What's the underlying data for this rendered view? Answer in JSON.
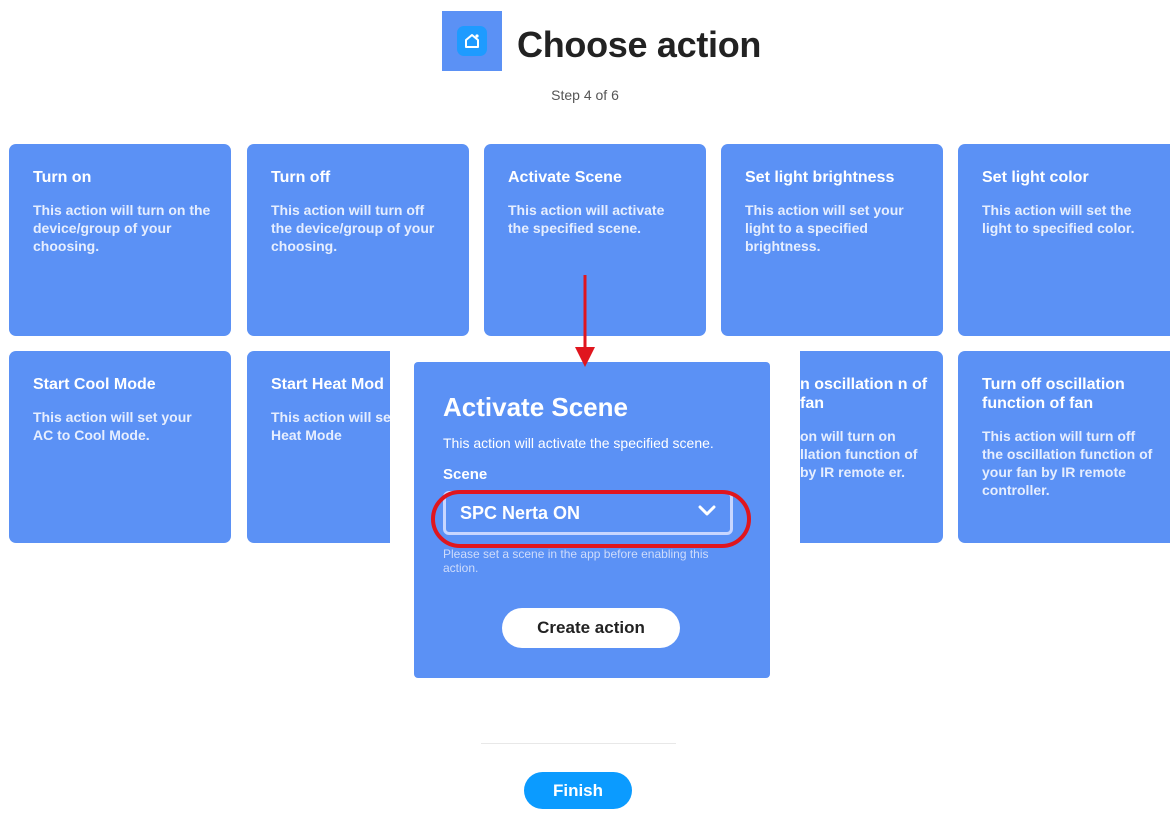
{
  "header": {
    "title": "Choose action",
    "step": "Step 4 of 6",
    "icon": "smartlife-home-icon"
  },
  "cards": [
    {
      "title": "Turn on",
      "description": "This action will turn on the device/group of your choosing."
    },
    {
      "title": "Turn off",
      "description": "This action will turn off the device/group of your choosing."
    },
    {
      "title": "Activate Scene",
      "description": "This action will activate the specified scene."
    },
    {
      "title": "Set light brightness",
      "description": "This action will set your light to a specified brightness."
    },
    {
      "title": "Set light color",
      "description": "This action will set the light to specified color."
    },
    {
      "title": "Start Cool Mode",
      "description": "This action will set your AC to Cool Mode."
    },
    {
      "title": "Start Heat Mod",
      "description": "This action will se AC to Heat Mode"
    },
    {
      "title": "n oscillation n of fan",
      "description": "on will turn on llation function of by IR remote er."
    },
    {
      "title": "Turn off oscillation function of fan",
      "description": "This action will turn off the oscillation function of your fan by IR remote controller."
    }
  ],
  "modal": {
    "title": "Activate Scene",
    "description": "This action will activate the specified scene.",
    "field_label": "Scene",
    "selected_scene": "SPC Nerta ON",
    "help_text": "Please set a scene in the app before enabling this action.",
    "create_button": "Create action"
  },
  "footer": {
    "finish_button": "Finish"
  },
  "colors": {
    "card_blue": "#5b91f5",
    "finish_blue": "#0b9bff",
    "highlight_red": "#e0161e"
  }
}
